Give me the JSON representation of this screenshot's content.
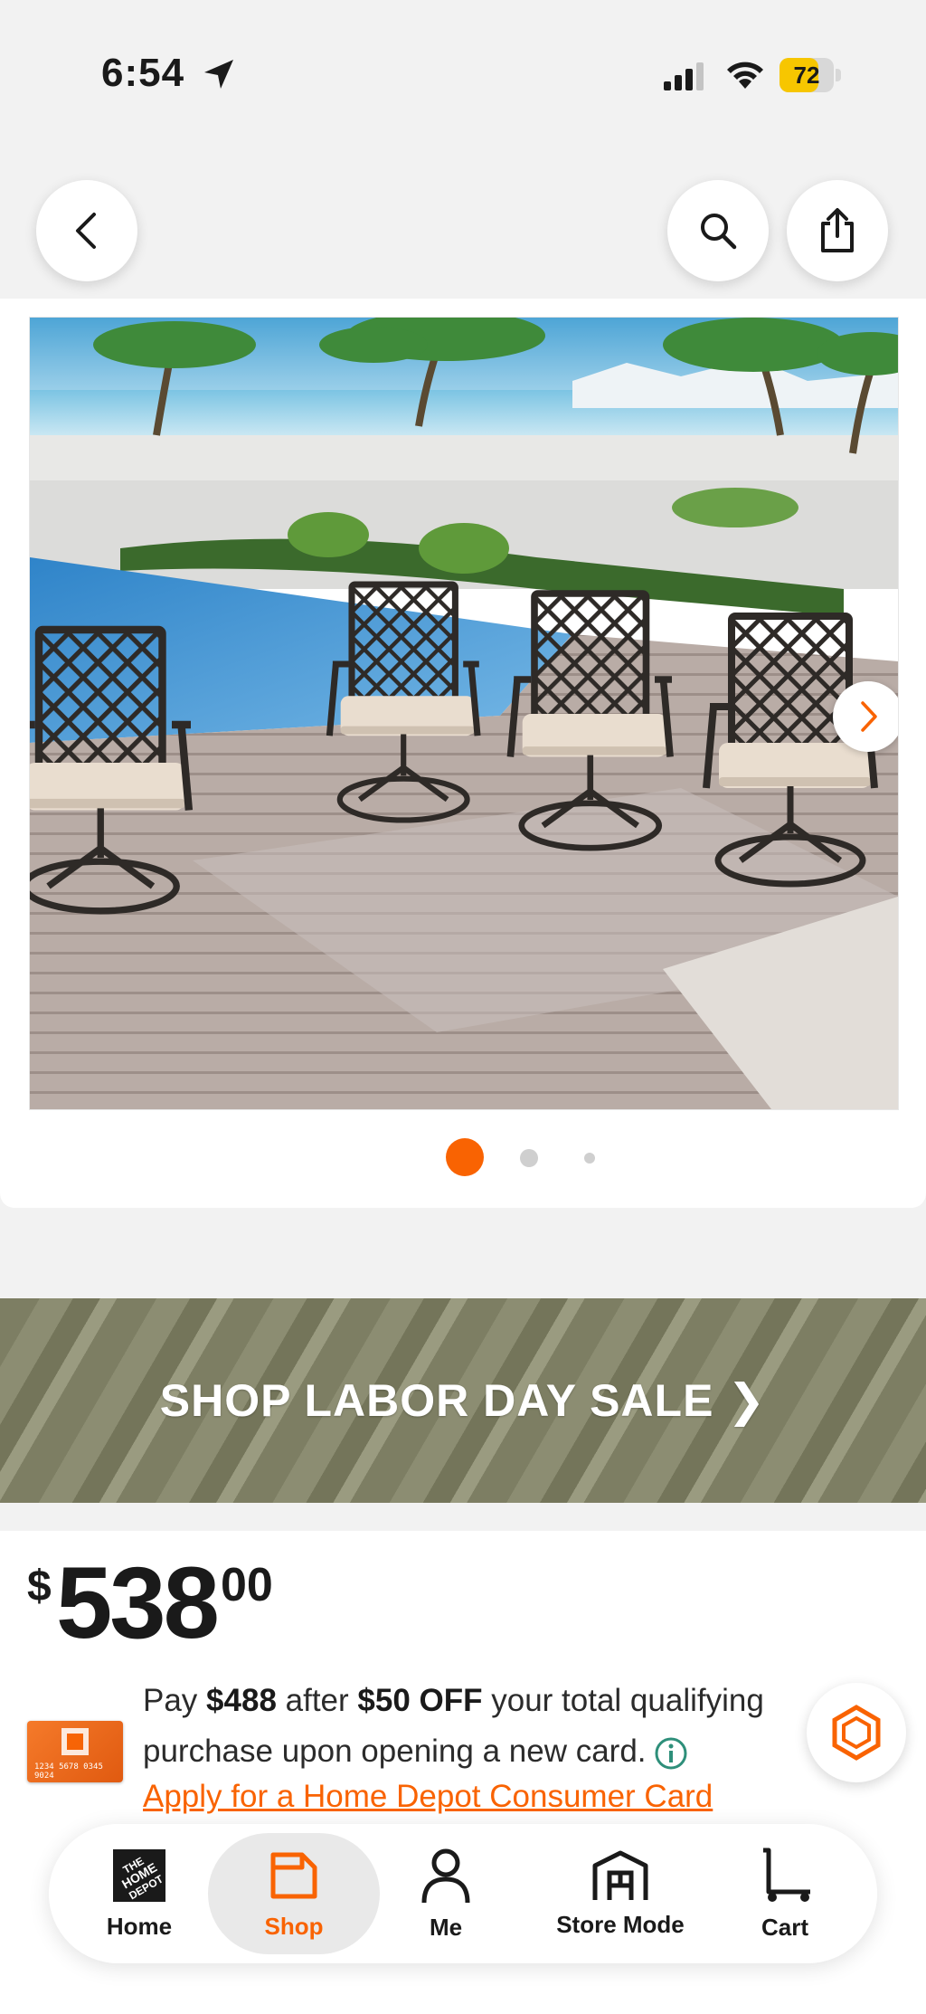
{
  "status_bar": {
    "time": "6:54",
    "battery": "72",
    "battery_level": 0.72,
    "battery_color": "#f7c600"
  },
  "nav": {
    "back_icon": "chevron-left-icon",
    "search_icon": "search-icon",
    "share_icon": "share-icon"
  },
  "gallery": {
    "image_subject": "product photo",
    "dot_count": 3,
    "active_index": 0,
    "next_icon": "chevron-right-icon"
  },
  "banner": {
    "text": "SHOP LABOR DAY SALE ❯",
    "color": "#7d7e63"
  },
  "price": {
    "symbol": "$",
    "dollars": "538",
    "cents": "00"
  },
  "promo": {
    "pay_prefix": "Pay ",
    "pay_amount": "$488",
    "after_text": " after ",
    "discount": "$50 OFF",
    "rest_text": " your total qualifying purchase upon opening a new card.",
    "card_number": "1234 5678 0345 9024",
    "apply_link": "Apply for a Home Depot Consumer Card"
  },
  "tab_bar": {
    "accent": "#f96302",
    "tabs": [
      {
        "label": "Home",
        "icon": "home-depot-logo-icon",
        "active": false
      },
      {
        "label": "Shop",
        "icon": "shop-icon",
        "active": true
      },
      {
        "label": "Me",
        "icon": "person-icon",
        "active": false
      },
      {
        "label": "Store Mode",
        "icon": "store-icon",
        "active": false
      },
      {
        "label": "Cart",
        "icon": "cart-icon",
        "active": false
      }
    ]
  }
}
